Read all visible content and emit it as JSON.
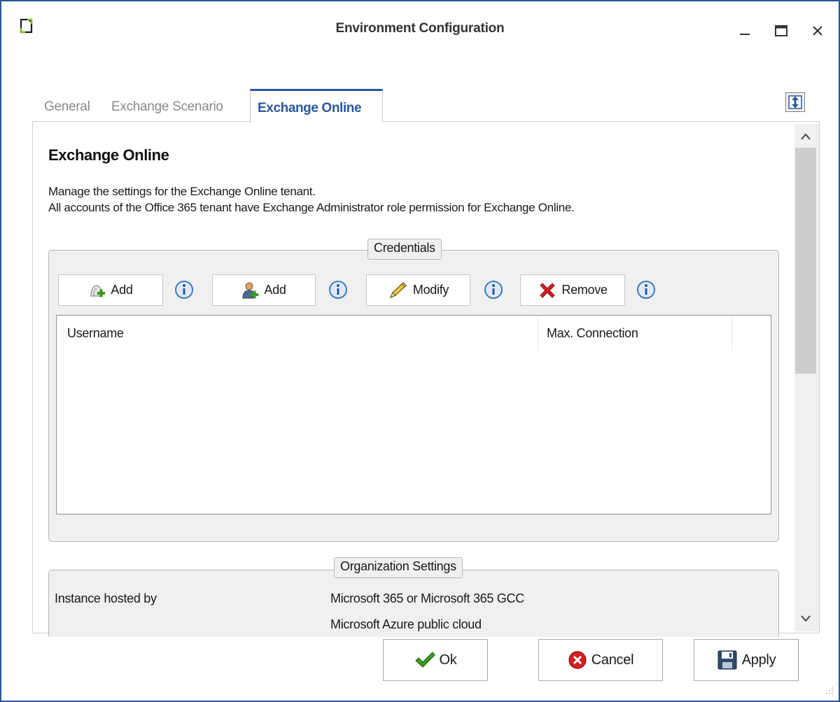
{
  "window": {
    "title": "Environment Configuration",
    "controls": {
      "minimize": "minimize",
      "maximize": "maximize",
      "close": "close"
    }
  },
  "tabs": [
    {
      "label": "General",
      "active": false
    },
    {
      "label": "Exchange Scenario",
      "active": false
    },
    {
      "label": "Exchange Online",
      "active": true
    }
  ],
  "section": {
    "heading": "Exchange Online",
    "description_line1": "Manage the settings for the Exchange Online tenant.",
    "description_line2": "All accounts of the Office 365 tenant have Exchange Administrator role permission for Exchange Online."
  },
  "credentials": {
    "title": "Credentials",
    "buttons": {
      "add_group": "Add",
      "add_user": "Add",
      "modify": "Modify",
      "remove": "Remove"
    },
    "columns": [
      "Username",
      "Max. Connection"
    ],
    "rows": []
  },
  "organization": {
    "title": "Organization Settings",
    "label": "Instance hosted by",
    "options": [
      "Microsoft 365 or Microsoft 365 GCC",
      "Microsoft Azure public cloud"
    ]
  },
  "footer": {
    "ok": "Ok",
    "cancel": "Cancel",
    "apply": "Apply"
  },
  "colors": {
    "accent": "#2b579a",
    "app_icon": "#7bbf2a",
    "remove_red": "#d42020",
    "ok_green": "#3a9a1e",
    "info_blue": "#3f7bc0"
  }
}
